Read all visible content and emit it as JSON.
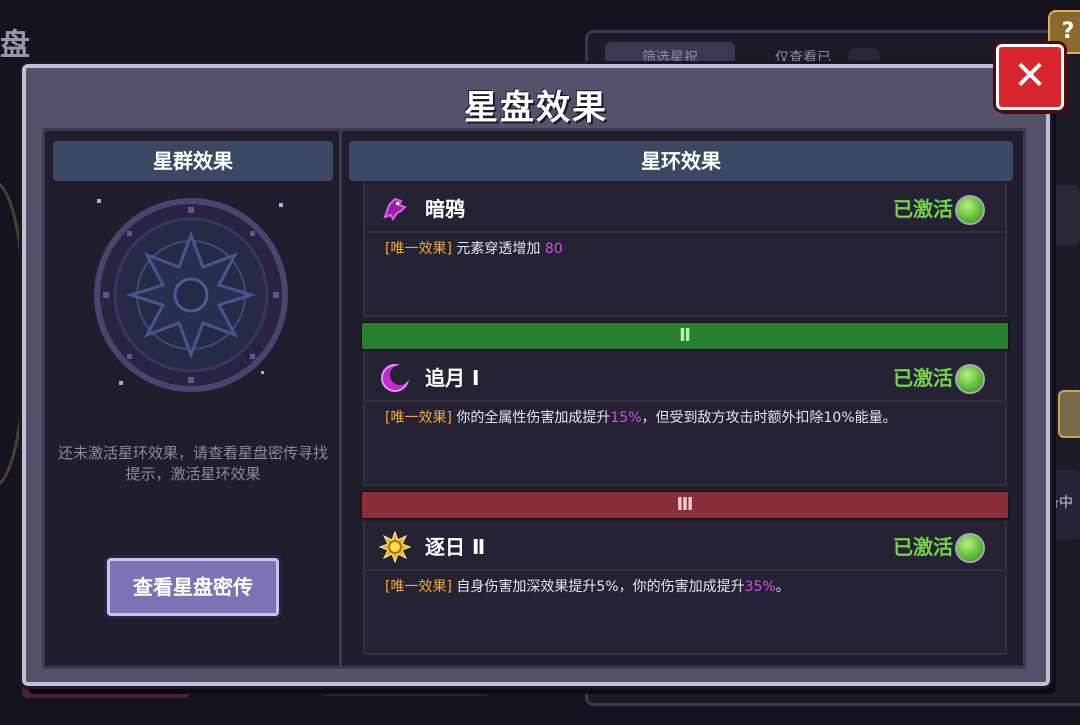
{
  "background": {
    "title_fragment": "盘",
    "tab1": "筛选星祝",
    "tab2": "仅查看已",
    "help": "?",
    "side_label": "备中"
  },
  "modal": {
    "title": "星盘效果",
    "close_label": "✕",
    "left": {
      "header": "星群效果",
      "hint": "还未激活星环效果，请查看星盘密传寻找提示，激活星环效果",
      "button": "查看星盘密传"
    },
    "right": {
      "header": "星环效果",
      "effects": [
        {
          "icon": "crow-icon",
          "name": "暗鸦",
          "status": "已激活",
          "tag": "[唯一效果]",
          "text_a": "元素穿透增加",
          "value_a": "80",
          "text_b": "",
          "value_b": "",
          "text_c": ""
        },
        {
          "icon": "crescent-moon-icon",
          "name": "追月 Ⅰ",
          "status": "已激活",
          "tag": "[唯一效果]",
          "text_a": "你的全属性伤害加成提升",
          "value_a": "15%",
          "text_b": "，但受到敌方攻击时额外扣除10%能量。",
          "value_b": "",
          "text_c": ""
        },
        {
          "icon": "sun-icon",
          "name": "逐日 Ⅱ",
          "status": "已激活",
          "tag": "[唯一效果]",
          "text_a": "自身伤害加深效果提升5%，你的伤害加成提升",
          "value_a": "35%",
          "text_b": "。",
          "value_b": "",
          "text_c": ""
        }
      ],
      "tiers": [
        "Ⅱ",
        "Ⅲ"
      ]
    }
  },
  "colors": {
    "tag": "#f0a832",
    "highlight": "#d54be8",
    "status": "#74d24a",
    "tier2": "#27802f",
    "tier3": "#8a2e3a"
  }
}
